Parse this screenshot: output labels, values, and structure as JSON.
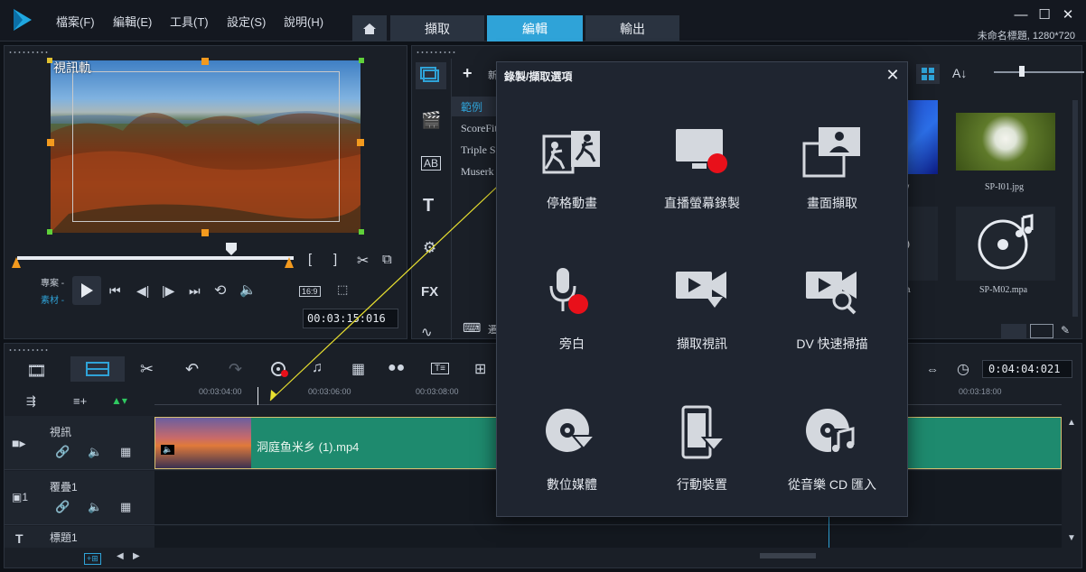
{
  "menu": {
    "file": "檔案(F)",
    "edit": "編輯(E)",
    "tools": "工具(T)",
    "settings": "設定(S)",
    "help": "說明(H)"
  },
  "tabs": {
    "capture": "擷取",
    "edit": "編輯",
    "output": "輸出"
  },
  "project_info": "未命名標題, 1280*720",
  "preview": {
    "overlay_text": "視訊軌",
    "timecode": "00:03:15:016",
    "aspect": "16:9",
    "mode_project": "專案 -",
    "mode_clip": "素材 -"
  },
  "library": {
    "add_label": "新",
    "category_label": "範例",
    "items": [
      "ScoreFit",
      "Triple S",
      "Muserk"
    ],
    "thumbs": {
      "t1": "SP-I01.jpg",
      "t2": "SP-M02.mpa",
      "t3": "w",
      "t4": "a"
    },
    "bottom_label": "遷"
  },
  "timeline": {
    "ruler": [
      "00:03:04:00",
      "00:03:06:00",
      "00:03:08:00",
      "00:03:18:00"
    ],
    "duration": "0:04:04:021",
    "tracks": {
      "video": "視訊",
      "overlay": "覆疊1",
      "title": "標題1"
    },
    "clip_name": "洞庭鱼米乡 (1).mp4",
    "bottom_btn": "+⊞"
  },
  "dialog": {
    "title": "錄製/擷取選項",
    "options": [
      "停格動畫",
      "直播螢幕錄製",
      "畫面擷取",
      "旁白",
      "擷取視訊",
      "DV 快速掃描",
      "數位媒體",
      "行動裝置",
      "從音樂 CD 匯入"
    ]
  },
  "colors": {
    "accent": "#2fa3d8",
    "clip": "#1e8a6e",
    "record": "#e8101a",
    "handle": "#f39a1e"
  }
}
